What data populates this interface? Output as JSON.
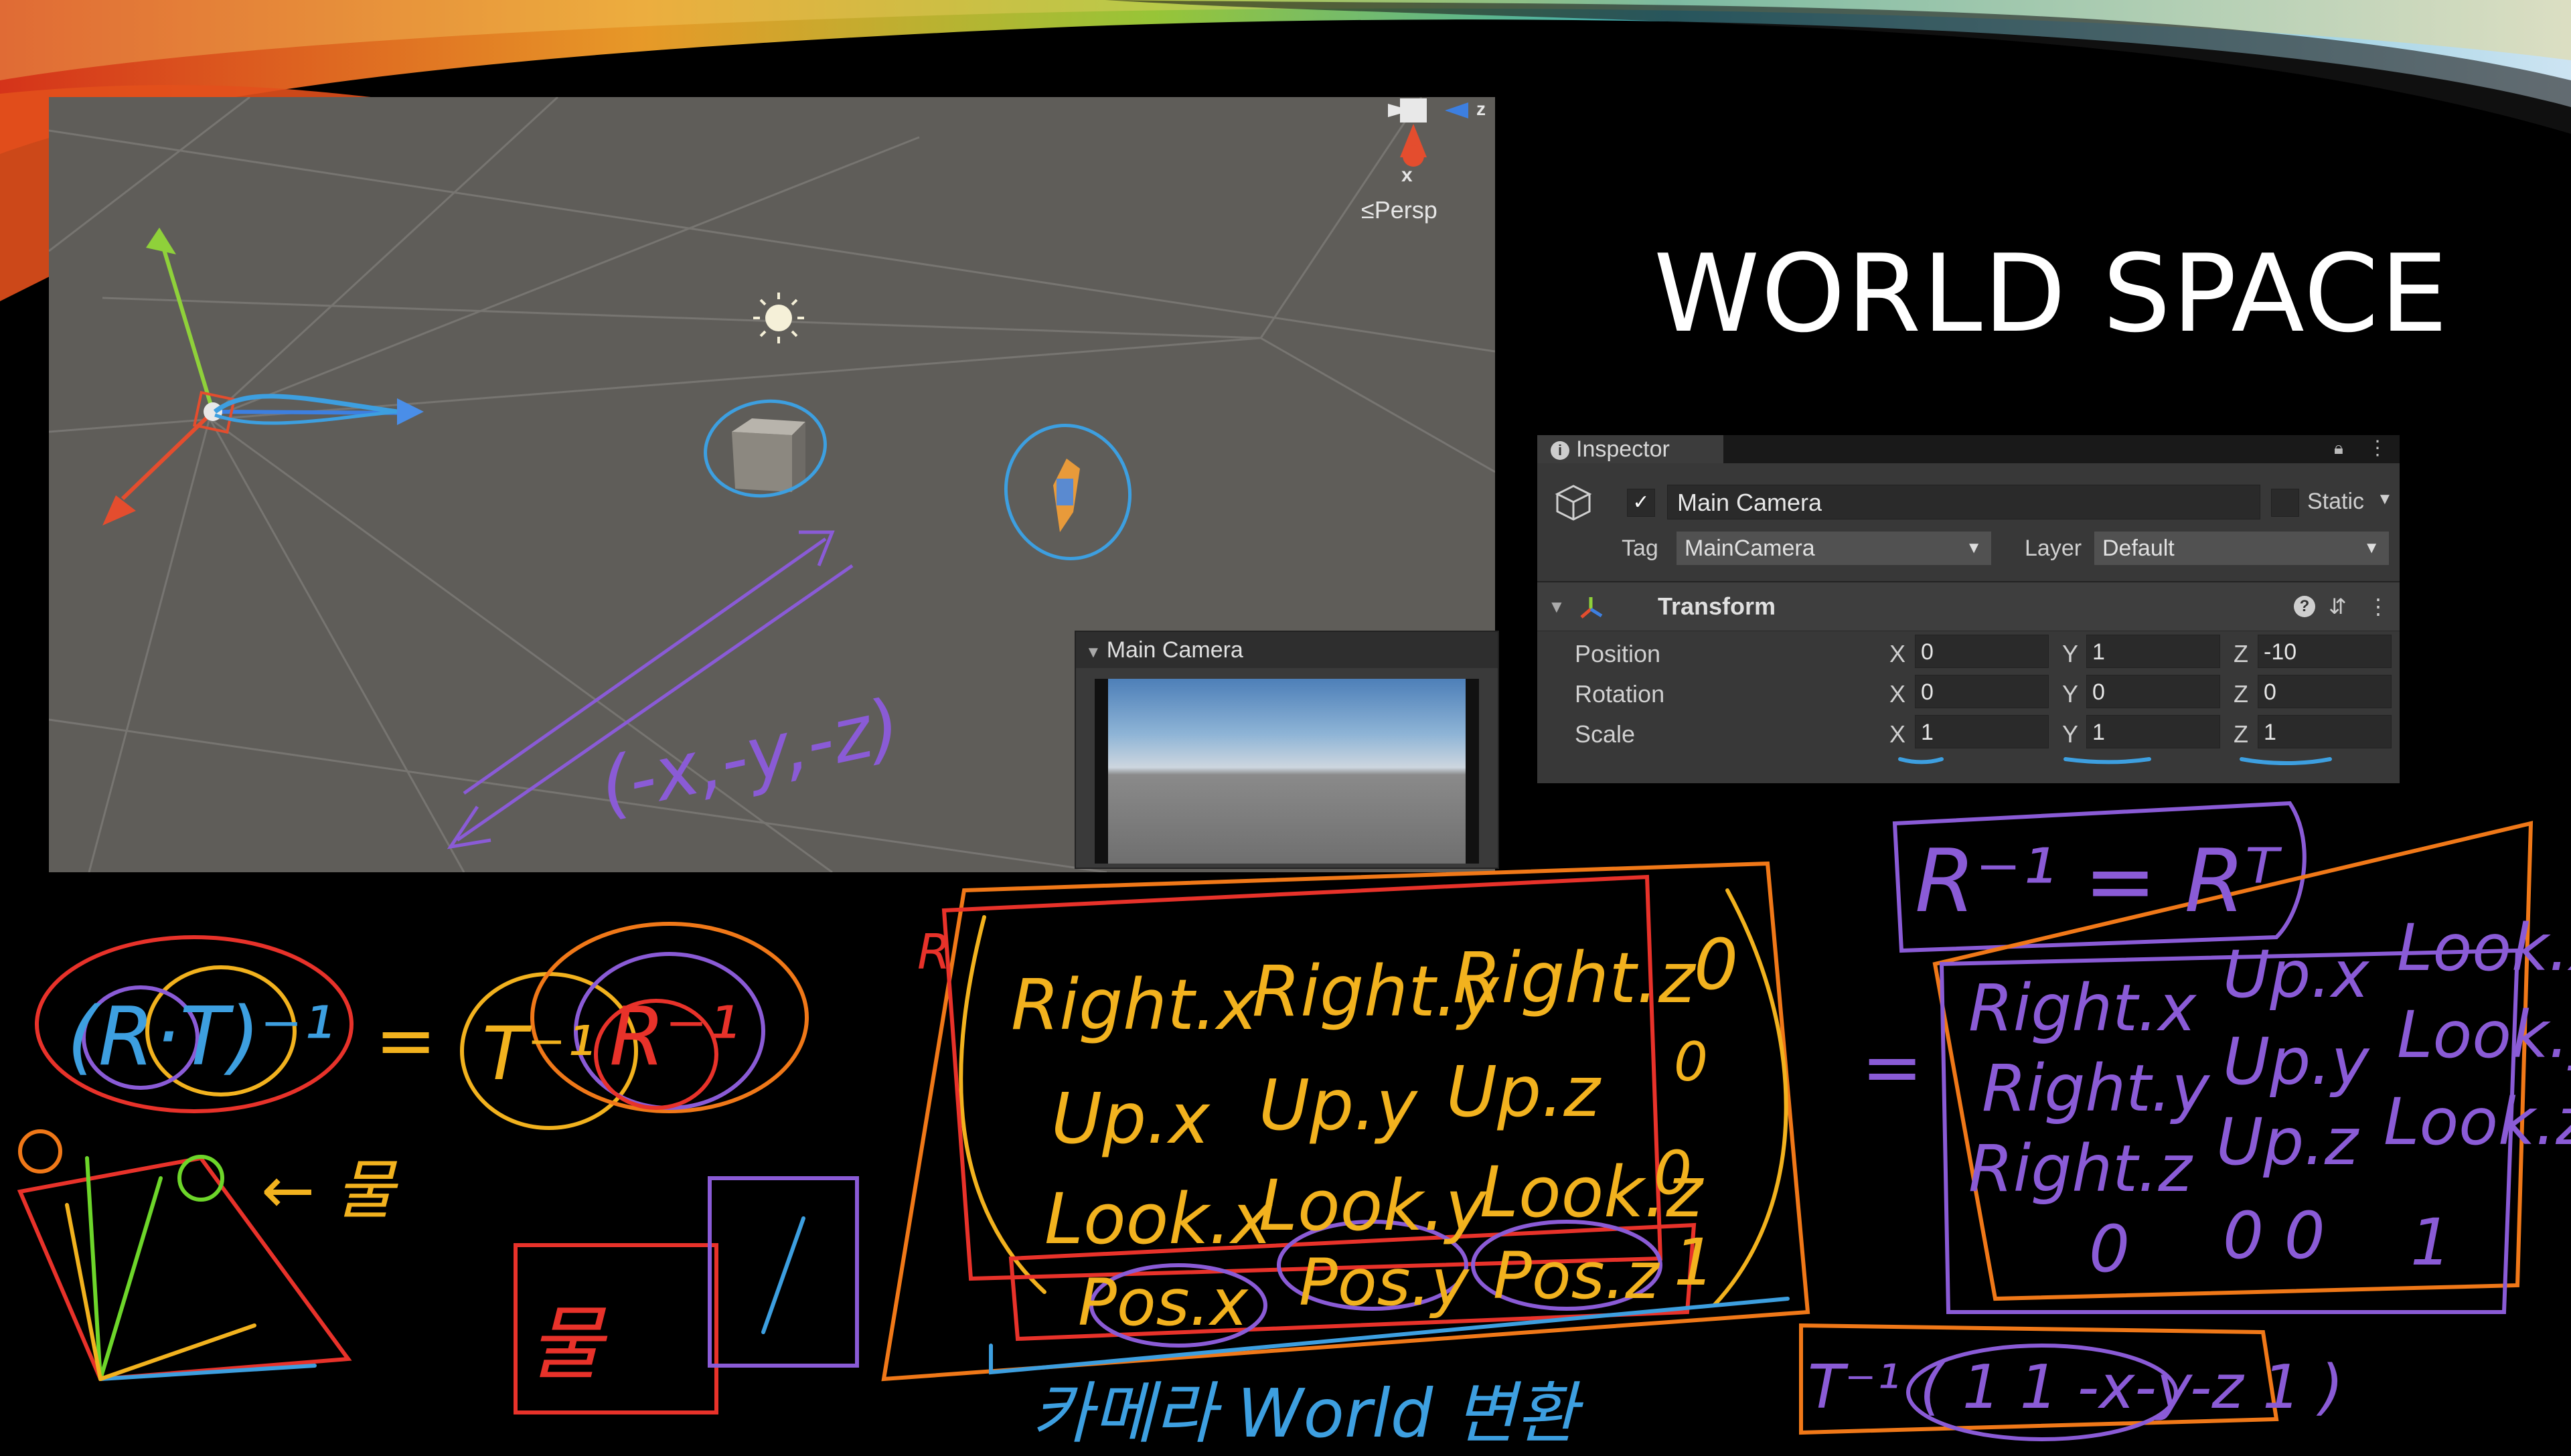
{
  "slide": {
    "title": "WORLD SPACE"
  },
  "scene_view": {
    "persp_label": "≤Persp",
    "gizmo_x_label": "x",
    "gizmo_z_label": "z",
    "annotation_vector": "(-x,-y,-z)"
  },
  "camera_preview": {
    "title": "Main Camera"
  },
  "inspector": {
    "tab_label": "Inspector",
    "object_name": "Main Camera",
    "active": true,
    "static_label": "Static",
    "tag_label": "Tag",
    "tag_value": "MainCamera",
    "layer_label": "Layer",
    "layer_value": "Default",
    "component_title": "Transform",
    "rows": [
      {
        "label": "Position",
        "x": "0",
        "y": "1",
        "z": "-10"
      },
      {
        "label": "Rotation",
        "x": "0",
        "y": "0",
        "z": "0"
      },
      {
        "label": "Scale",
        "x": "1",
        "y": "1",
        "z": "1"
      }
    ],
    "axis": {
      "x": "X",
      "y": "Y",
      "z": "Z"
    }
  },
  "handwriting": {
    "rt_inverse": "(R·T)⁻¹",
    "equals": "=",
    "t_inverse": "T⁻¹",
    "r_inverse": "R⁻¹",
    "arrow_obj": "← 물",
    "r_mark": "R",
    "matrix_rows": [
      [
        "Right.x",
        "Right.y",
        "Right.z",
        "0"
      ],
      [
        "Up.x",
        "Up.y",
        "Up.z",
        "0"
      ],
      [
        "Look.x",
        "Look.y",
        "Look.z",
        "0"
      ],
      [
        "Pos.x",
        "Pos.y",
        "Pos.z",
        "1"
      ]
    ],
    "caption": "카메라 World 변환",
    "r_inv_eq": "R⁻¹ = Rᵀ",
    "equals2": "=",
    "transposed_rows": [
      [
        "Right.x",
        "Up.x",
        "Look.x"
      ],
      [
        "Right.y",
        "Up.y",
        "Look.y"
      ],
      [
        "Right.z",
        "Up.z",
        "Look.z"
      ],
      [
        "0",
        "0 0",
        "1"
      ]
    ],
    "t_inverse_vec": "T⁻¹ ( 1 1 -x-y-z 1 )",
    "box_obj": "물"
  },
  "colors": {
    "scene_bg": "#5f5d59",
    "ink_yellow": "#f2b21e",
    "ink_orange": "#f07818",
    "ink_red": "#e8322a",
    "ink_blue": "#3d9fe0",
    "ink_purple": "#8a5bd6",
    "ink_green": "#6dd62a"
  }
}
